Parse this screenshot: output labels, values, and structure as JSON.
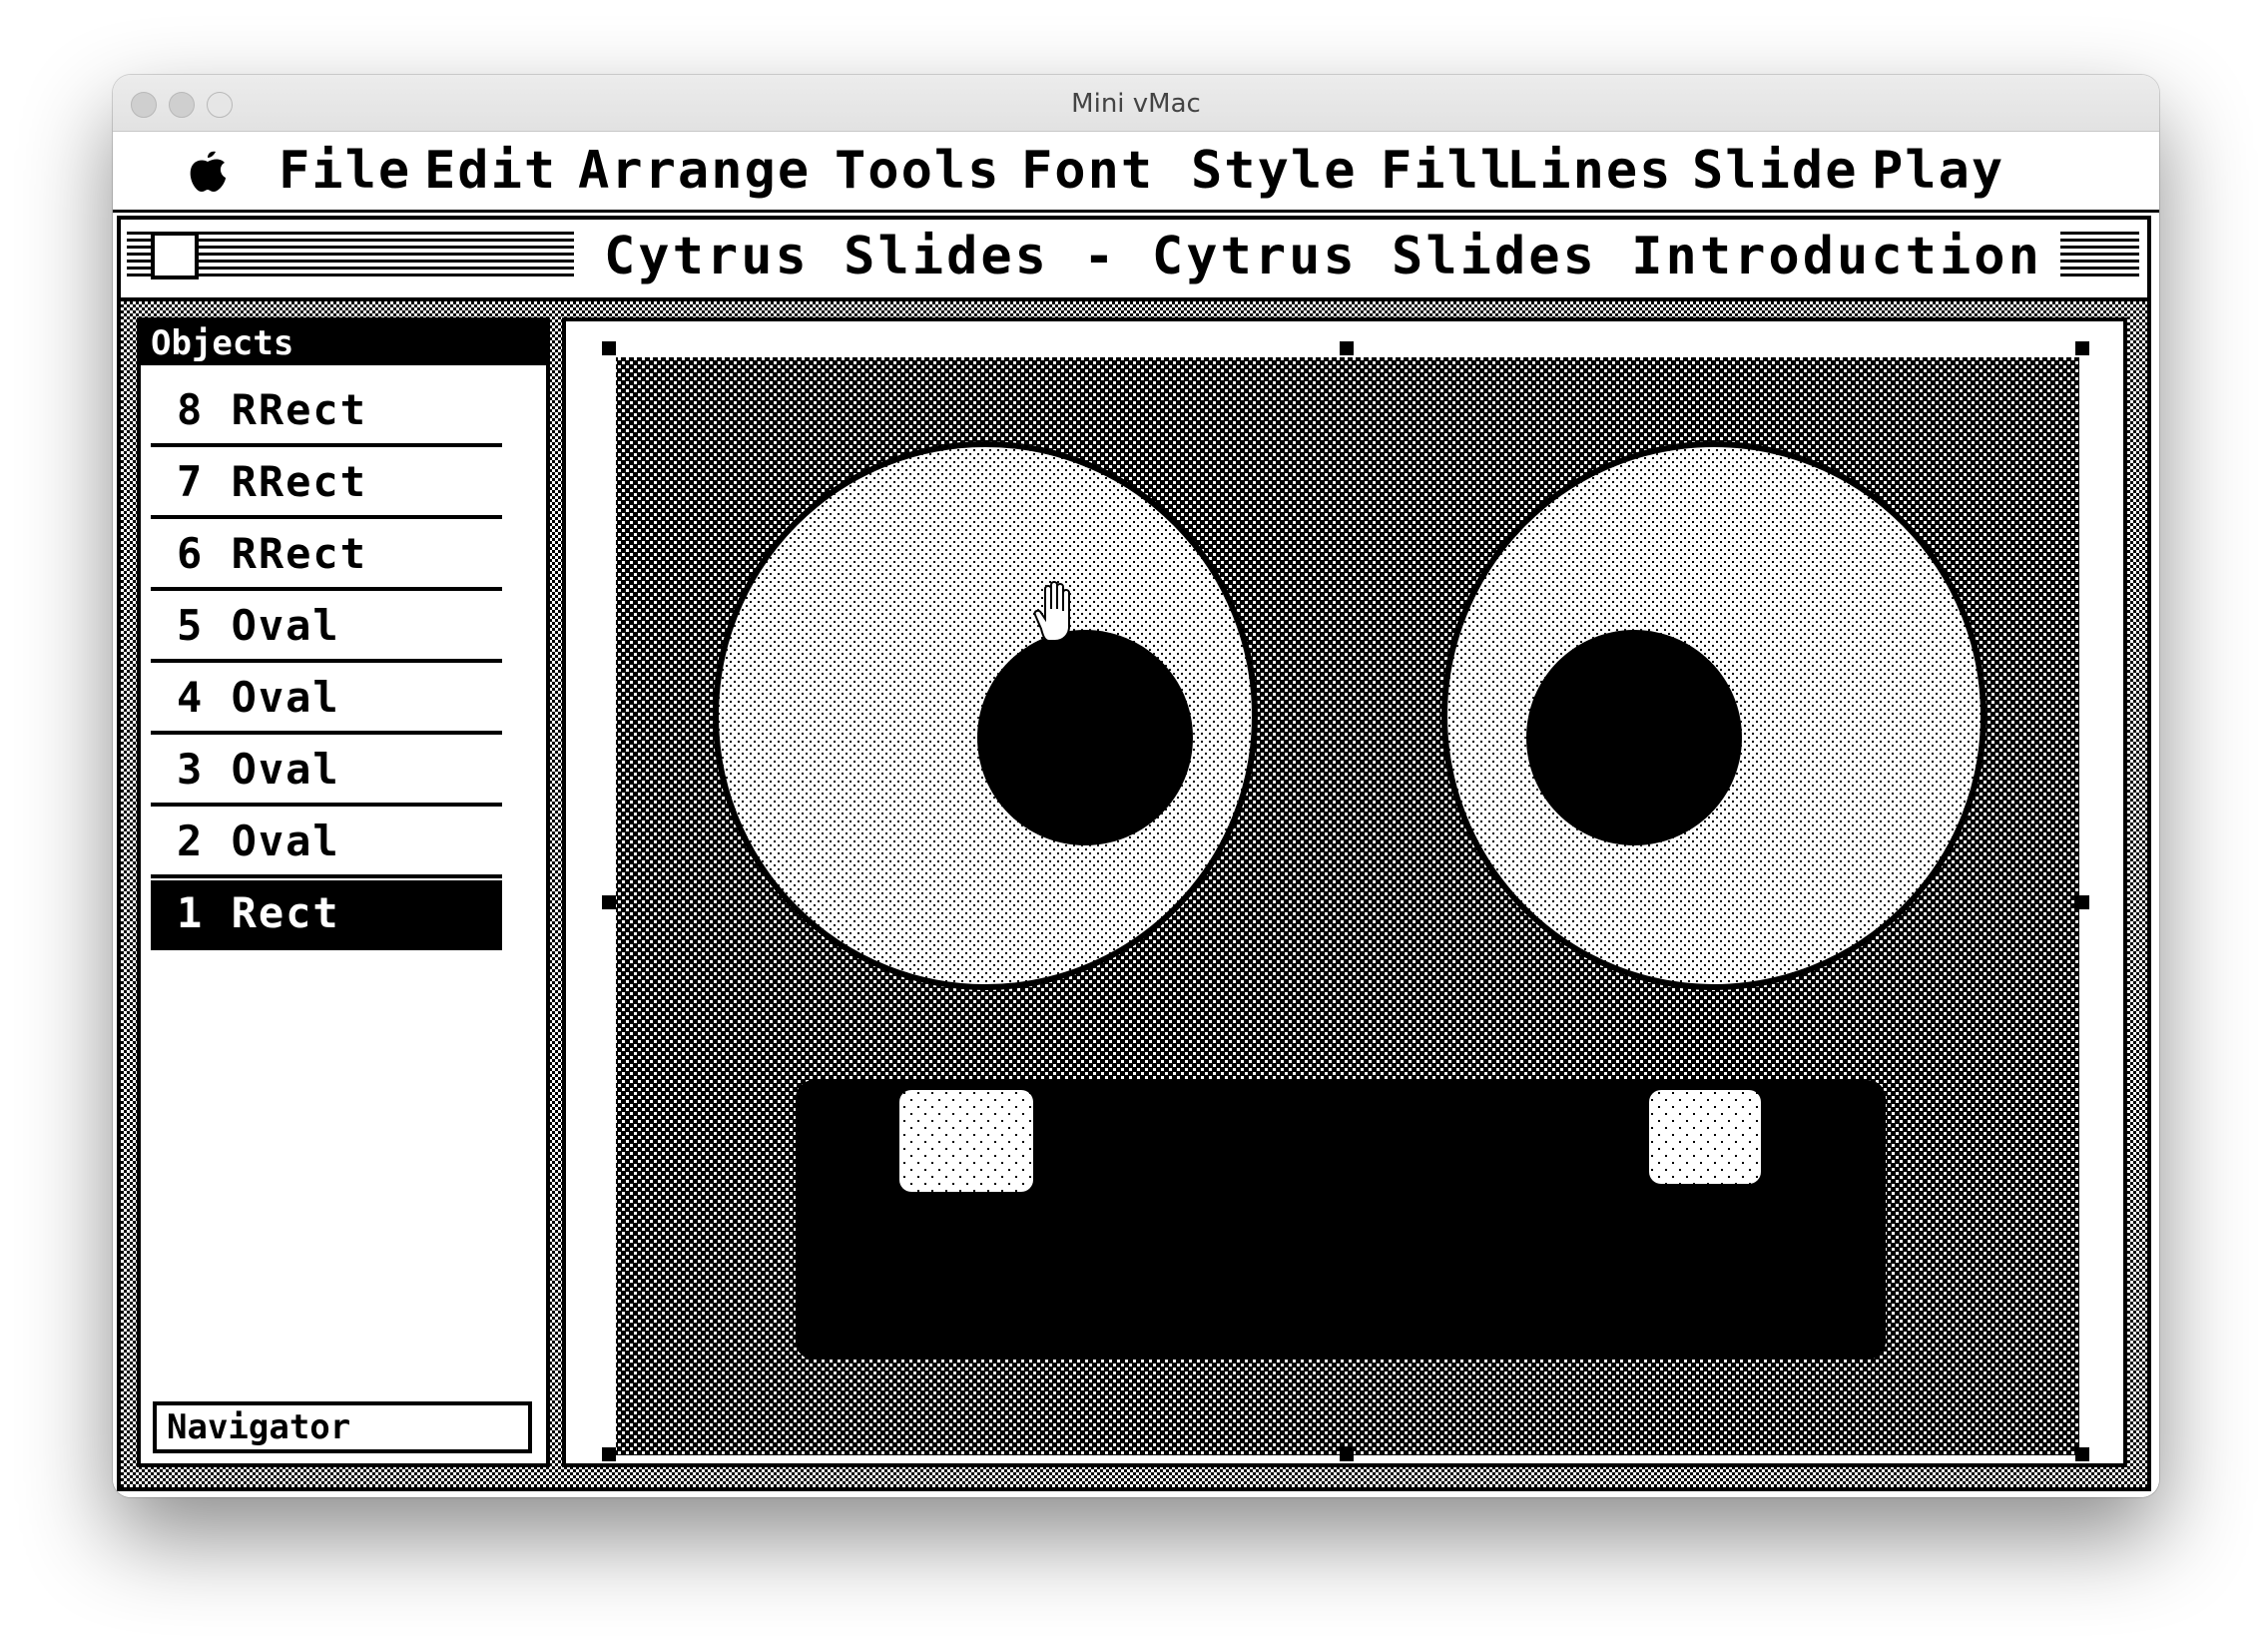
{
  "host_window": {
    "title": "Mini vMac"
  },
  "menubar": {
    "apple_icon": "apple-icon",
    "items": [
      "File",
      "Edit",
      "Arrange",
      "Tools",
      "Font",
      "Style",
      "Fill",
      "Lines",
      "Slide",
      "Play"
    ]
  },
  "document": {
    "title": "Cytrus Slides - Cytrus Slides Introduction"
  },
  "objects_panel": {
    "header": "Objects",
    "items": [
      {
        "label": "8 RRect",
        "selected": false
      },
      {
        "label": "7 RRect",
        "selected": false
      },
      {
        "label": "6 RRect",
        "selected": false
      },
      {
        "label": "5 Oval",
        "selected": false
      },
      {
        "label": "4 Oval",
        "selected": false
      },
      {
        "label": "3 Oval",
        "selected": false
      },
      {
        "label": "2 Oval",
        "selected": false
      },
      {
        "label": "1 Rect",
        "selected": true
      }
    ],
    "navigator_label": "Navigator"
  },
  "slide": {
    "selected_object": "1 Rect",
    "cursor_icon": "hand-cursor-icon"
  }
}
